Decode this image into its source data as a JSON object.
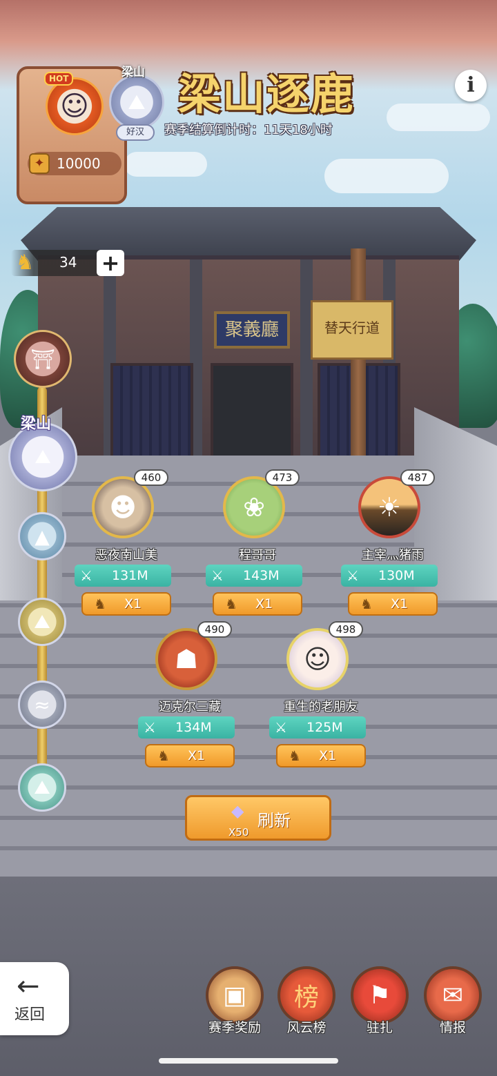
{
  "header": {
    "title": "梁山逐鹿",
    "countdown": "赛季结算倒计时：11天18小时"
  },
  "player": {
    "hot_badge": "HOT",
    "coins": "10000",
    "rank_name": "梁山",
    "rank_tag": "好汉"
  },
  "horse_counter": {
    "value": "34",
    "plus": "+"
  },
  "scene": {
    "plaque": "聚義廳",
    "banner": "替天行道"
  },
  "ladder": {
    "current_label": "梁山"
  },
  "opponents": [
    {
      "name": "恶夜南山美",
      "level": "460",
      "power": "131M",
      "cost": "X1",
      "avatar_color": "#4a3a3a"
    },
    {
      "name": "程哥哥",
      "level": "473",
      "power": "143M",
      "cost": "X1",
      "avatar_color": "#7db35a"
    },
    {
      "name": "主宰灬猪雨",
      "level": "487",
      "power": "130M",
      "cost": "X1",
      "avatar_color": "#c07a3a"
    },
    {
      "name": "迈克尔三藏",
      "level": "490",
      "power": "134M",
      "cost": "X1",
      "avatar_color": "#a03020"
    },
    {
      "name": "重生的老朋友",
      "level": "498",
      "power": "125M",
      "cost": "X1",
      "avatar_color": "#e8e0ea"
    }
  ],
  "refresh": {
    "label": "刷新",
    "cost": "X50"
  },
  "back": {
    "label": "返回"
  },
  "menu": [
    {
      "label": "赛季奖励",
      "icon": "treasure-chest-icon"
    },
    {
      "label": "风云榜",
      "icon": "scroll-rank-icon"
    },
    {
      "label": "驻扎",
      "icon": "flag-icon"
    },
    {
      "label": "情报",
      "icon": "report-icon"
    }
  ],
  "colors": {
    "power_bar": "#4cc3b2",
    "button_orange": "#f5a93a",
    "title_gold": "#f5d36c"
  }
}
